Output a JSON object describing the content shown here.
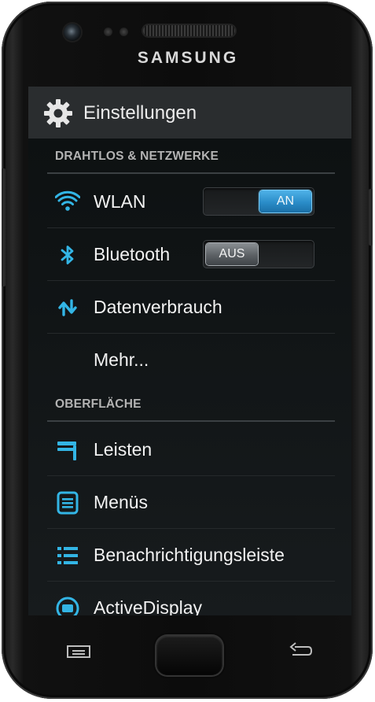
{
  "device": {
    "brand": "SAMSUNG"
  },
  "app": {
    "title": "Einstellungen",
    "title_icon": "gear-icon"
  },
  "sections": [
    {
      "header": "DRAHTLOS & NETZWERKE",
      "items": [
        {
          "label": "WLAN",
          "icon": "wifi-icon",
          "toggle": "AN",
          "toggle_state": "on"
        },
        {
          "label": "Bluetooth",
          "icon": "bluetooth-icon",
          "toggle": "AUS",
          "toggle_state": "off"
        },
        {
          "label": "Datenverbrauch",
          "icon": "data-usage-icon"
        },
        {
          "label": "Mehr...",
          "icon": ""
        }
      ]
    },
    {
      "header": "OBERFLÄCHE",
      "items": [
        {
          "label": "Leisten",
          "icon": "bars-icon"
        },
        {
          "label": "Menüs",
          "icon": "menu-document-icon"
        },
        {
          "label": "Benachrichtigungsleiste",
          "icon": "notification-list-icon"
        },
        {
          "label": "ActiveDisplay",
          "icon": "active-display-icon"
        }
      ]
    }
  ],
  "colors": {
    "accent": "#33b5e5",
    "toggle_on": "#2a8cc8",
    "background": "#0d1112"
  }
}
